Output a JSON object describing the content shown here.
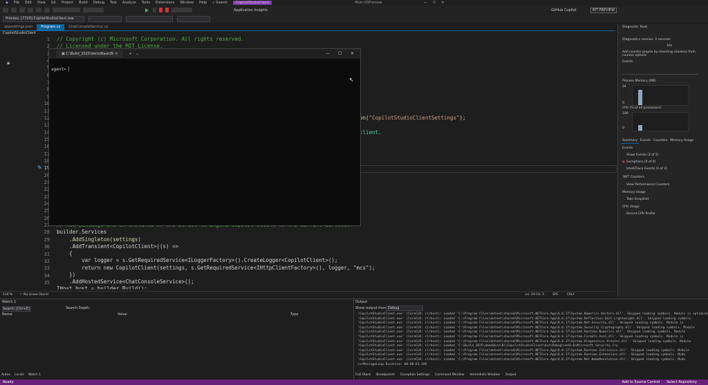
{
  "menu": [
    "File",
    "Edit",
    "View",
    "Git",
    "Project",
    "Build",
    "Debug",
    "Test",
    "Analyze",
    "Tools",
    "Extensions",
    "Window",
    "Help"
  ],
  "search_label": "Search",
  "solution_pill": "CopilotStudioClient",
  "window_title": "Main-VSPreview",
  "copilot_label": "GitHub Copilot",
  "int_preview": "INT PREVIEW",
  "process_label": "Process: [7720] CopilotStudioClient.exe",
  "app_insights": "Application Insights",
  "tabs": [
    "appsettings.json",
    "Program.cs",
    "ChatConsoleService.cs"
  ],
  "project_label": "CopilotStudioClient",
  "line_numbers": [
    "1",
    "2",
    "3",
    "4",
    "5",
    "6",
    "7",
    "8",
    "9",
    "10",
    "11",
    "12",
    "13",
    "14",
    "15",
    "16",
    "17",
    "18",
    "19",
    "20",
    "21",
    "22",
    "23",
    "24",
    "25",
    "26",
    "27",
    "28",
    "29",
    "30",
    "31",
    "32",
    "33",
    "34",
    "35"
  ],
  "code": {
    "l1": "// Copyright (c) Microsoft Corporation. All rights reserved.",
    "l2": "// Licensed under the MIT License.",
    "l15_tail": "on(\"CopilotStudioClientSettings\");",
    "l17_tail": "client.",
    "l27": "// Add Settings and an instance of the Direct to Engine Copilot Client to the Current Services.",
    "l28": "builder.Services",
    "l29": "    .AddSingleton(settings)",
    "l30": "    .AddTransient<CopilotClient>((s) =>",
    "l31": "    {",
    "l32": "        var logger = s.GetRequiredService<ILoggerFactory>().CreateLogger<CopilotClient>();",
    "l33": "        return new CopilotClient(settings, s.GetRequiredService<IHttpClientFactory>(), logger, \"mcs\");",
    "l34": "    })",
    "l35": "    .AddHostedService<ChatConsoleService>();",
    "l36": "IHost host = builder.Build();"
  },
  "terminal": {
    "tab_title": "C:\\Build_2025\\demoBase\\Bi",
    "prompt": "agent> "
  },
  "diag": {
    "title": "Diagnostic Tools",
    "session": "Diagnostics session: 3 seconds",
    "time_tick": "10s",
    "hint": "Add counter graphs by checking counters from counter options",
    "events": "Events",
    "process_memory": "Process Memory (MB)",
    "mem_max": "24",
    "mem_min": "0",
    "cpu": "CPU (% of all processors)",
    "cpu_max": "100",
    "cpu_min": "0",
    "tabs": [
      "Summary",
      "Events",
      "Counters",
      "Memory Usage"
    ],
    "events_h": "Events",
    "show_events": "Show Events (2 of 2)",
    "exceptions": "Exceptions (0 of 0)",
    "intellitrace": "IntelliTrace Events (2 of 2)",
    "dotnet_counters": ".NET Counters",
    "view_perf": "View Performance Counters",
    "memory_usage": "Memory Usage",
    "take_snapshot": "Take Snapshot",
    "cpu_usage": "CPU Usage",
    "record_cpu": "Record CPU Profile"
  },
  "editor_status": {
    "zoom": "110 %",
    "issues": "No issues found",
    "position": "Ln: 19  Ch: 5",
    "spc": "SPC",
    "crlf": "CRLF"
  },
  "watch": {
    "title": "Watch 1",
    "search": "Search (Ctrl+E)",
    "search_depth": "Search Depth:",
    "cols": [
      "Name",
      "Value",
      "Type"
    ]
  },
  "output": {
    "title": "Output",
    "show_from": "Show output from:",
    "source": "Debug",
    "lines": [
      "'CopilotStudioClient.exe' (CoreCLR: clrhost): Loaded 'C:\\Program Files\\dotnet\\shared\\Microsoft.NETCore.App\\8.0.17\\System.Numerics.Vectors.dll'. Skipped loading symbols. Module is optimized",
      "'CopilotStudioClient.exe' (CoreCLR: clrhost): Loaded 'C:\\Program Files\\dotnet\\shared\\Microsoft.NETCore.App\\8.0.17\\System.Reflection.Emit.Lightweight.dll'. Skipped loading symbols.",
      "'CopilotStudioClient.exe' (CoreCLR: clrhost): Loaded 'C:\\Program Files\\dotnet\\shared\\Microsoft.NETCore.App\\8.0.17\\System.Net.Security.dll'. Skipped loading symbols. Module is",
      "'CopilotStudioClient.exe' (CoreCLR: clrhost): Loaded 'C:\\Program Files\\dotnet\\shared\\Microsoft.NETCore.App\\8.0.17\\System.Security.Cryptography.dll'. Skipped loading symbols. Module",
      "'CopilotStudioClient.exe' (CoreCLR: clrhost): Loaded 'C:\\Program Files\\dotnet\\shared\\Microsoft.NETCore.App\\8.0.17\\System.Runtime.Numerics.dll'. Skipped loading symbols. Module",
      "'CopilotStudioClient.exe' (CoreCLR: clrhost): Loaded 'C:\\Program Files\\dotnet\\shared\\Microsoft.NETCore.App\\8.0.17\\System.Formats.Asn1.dll'. Skipped loading symbols. Module is",
      "'CopilotStudioClient.exe' (CoreCLR: clrhost): Loaded 'C:\\Program Files\\dotnet\\shared\\Microsoft.NETCore.App\\8.0.17\\System.Diagnostics.Process.dll'. Skipped loading symbols. Module",
      "'CopilotStudioClient.exe' (CoreCLR: clrhost): Loaded 'C:\\Build_2025\\demoBase\\Bi\\CopilotStudioClient\\bin\\Debug\\net8.0\\Microsoft.Security.Cry",
      "'CopilotStudioClient.exe' (CoreCLR: clrhost): Loaded 'C:\\Program Files\\dotnet\\shared\\Microsoft.NETCore.App\\8.0.17\\System.Runtime.Intrinsics.dll'. Skipped loading symbols. Module",
      "'CopilotStudioClient.exe' (CoreCLR: clrhost): Loaded 'C:\\Program Files\\dotnet\\shared\\Microsoft.NETCore.App\\8.0.17\\System.Runtime.Extensions.dll'. Skipped loading symbols. Modu",
      "'CopilotStudioClient.exe' (CoreCLR: clrhost): Loaded 'C:\\Program Files\\dotnet\\shared\\Microsoft.NETCore.App\\8.0.17\\System.Net.NameResolution.dll'. Skipped loading symbols. Modu",
      ">>>MessageLoop Duration: 00:00:01.348"
    ],
    "tabs": [
      "Call Stack",
      "Breakpoints",
      "Exception Settings",
      "Command Window",
      "Immediate Window",
      "Output"
    ]
  },
  "watch_tabs": [
    "Autos",
    "Locals",
    "Watch 1"
  ],
  "status": {
    "ready": "Ready",
    "source_control": "Add to Source Control",
    "repo": "Select Repository"
  }
}
